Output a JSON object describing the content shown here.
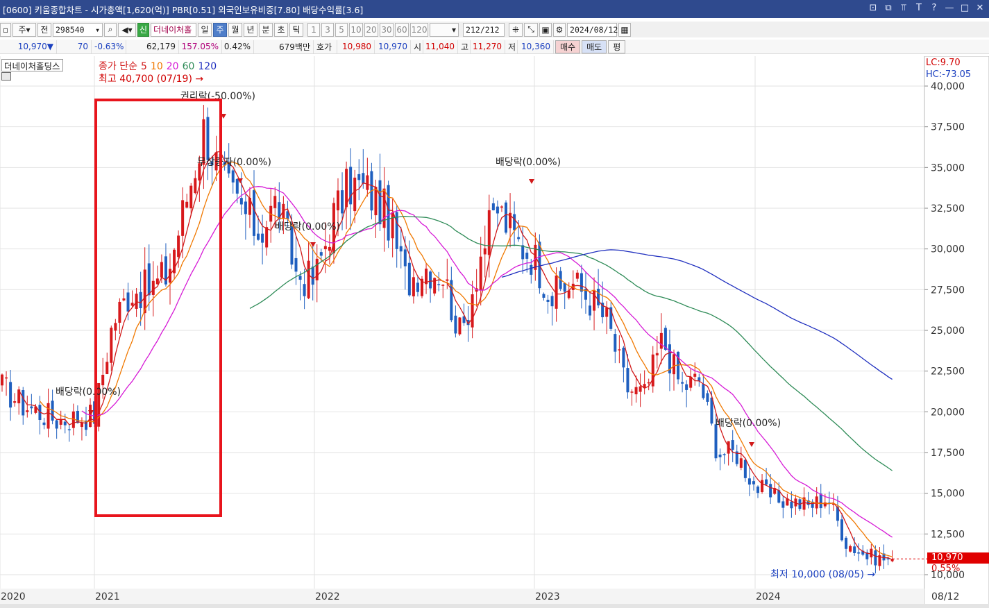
{
  "window": {
    "title": "[0600] 키움종합차트 - 시가총액[1,620(억)] PBR[0.51] 외국인보유비중[7.80] 배당수익률[3.6]",
    "controls": [
      "⊡",
      "⧉",
      "⫪",
      "T",
      "?",
      "—",
      "□",
      "✕"
    ]
  },
  "toolbar": {
    "period_unit": "주",
    "prev_label": "전",
    "code": "298540",
    "new_badge": "신",
    "stock_name": "더네이처홀",
    "periods": [
      "일",
      "주",
      "월",
      "년",
      "분",
      "초",
      "틱"
    ],
    "selected_period": "주",
    "intervals": [
      "1",
      "3",
      "5",
      "10",
      "20",
      "30",
      "60",
      "120"
    ],
    "count": "212",
    "count_total": "/212",
    "date": "2024/08/12"
  },
  "quote": {
    "price": "10,970",
    "arrow": "▼",
    "change": "70",
    "change_pct": "-0.63%",
    "volume": "62,179",
    "vol_ratio": "157.05%",
    "turnover": "0.42%",
    "amount": "679백만",
    "bid_label": "호가",
    "ask": "10,980",
    "bid": "10,970",
    "open_label": "시",
    "open": "11,040",
    "high_label": "고",
    "high": "11,270",
    "low_label": "저",
    "low": "10,360",
    "buy_btn": "매수",
    "sell_btn": "매도",
    "eval_btn": "평"
  },
  "chart_info": {
    "stock_label": "더네이처홀딩스",
    "legend_prefix": "종가 단순",
    "ma_periods": [
      "5",
      "10",
      "20",
      "60",
      "120"
    ],
    "ma_colors": [
      "#d11a1a",
      "#f07800",
      "#d61ad6",
      "#2e8b57",
      "#1f2fbf"
    ],
    "max_label": "최고 40,700 (07/19) →",
    "min_label": "최저 10,000 (08/05) →",
    "lc": "LC:9.70",
    "hc": "HC:-73.05",
    "current_price": "10,970",
    "current_pct": "0.55%",
    "annotations": {
      "rights1": "권리락(-50.00%)",
      "rights2": "무상증자(0.00%)",
      "div1": "배당락(0.00%)",
      "div2": "배당락(0.00%)",
      "div3": "배당락(0.00%)",
      "div4": "배당락(0.00%)"
    },
    "x_labels": [
      "2020",
      "2021",
      "2022",
      "2023",
      "2024",
      "08/12"
    ],
    "y_labels": [
      "40,000",
      "37,500",
      "35,000",
      "32,500",
      "30,000",
      "27,500",
      "25,000",
      "22,500",
      "20,000",
      "17,500",
      "15,000",
      "12,500",
      "10,000"
    ],
    "up_color": "#d7191c",
    "down_color": "#1f5fbf"
  },
  "chart_data": {
    "type": "candlestick",
    "y_ticks": [
      40000,
      37500,
      35000,
      32500,
      30000,
      27500,
      25000,
      22500,
      20000,
      17500,
      15000,
      12500,
      10000
    ],
    "ylim": [
      10000,
      40000
    ],
    "anchors": [
      {
        "date": "2019-12",
        "close": 23500
      },
      {
        "date": "2020-02",
        "close": 21000
      },
      {
        "date": "2020-03",
        "close": 18200
      },
      {
        "date": "2020-05",
        "close": 21500
      },
      {
        "date": "2020-07",
        "close": 22500
      },
      {
        "date": "2020-09",
        "close": 20500
      },
      {
        "date": "2020-11",
        "close": 19500
      },
      {
        "date": "2021-01",
        "close": 19800
      },
      {
        "date": "2021-02",
        "close": 25500
      },
      {
        "date": "2021-03",
        "close": 27500
      },
      {
        "date": "2021-04",
        "close": 27500
      },
      {
        "date": "2021-05",
        "close": 28500
      },
      {
        "date": "2021-06",
        "close": 33000
      },
      {
        "date": "2021-07",
        "close": 37500
      },
      {
        "date": "2021-08",
        "close": 34000
      },
      {
        "date": "2021-09",
        "close": 32500
      },
      {
        "date": "2021-10",
        "close": 31000
      },
      {
        "date": "2021-11",
        "close": 33000
      },
      {
        "date": "2021-12",
        "close": 28500
      },
      {
        "date": "2022-01",
        "close": 28000
      },
      {
        "date": "2022-02",
        "close": 32000
      },
      {
        "date": "2022-03",
        "close": 34000
      },
      {
        "date": "2022-04",
        "close": 33500
      },
      {
        "date": "2022-05",
        "close": 32000
      },
      {
        "date": "2022-06",
        "close": 28000
      },
      {
        "date": "2022-07",
        "close": 29000
      },
      {
        "date": "2022-08",
        "close": 28500
      },
      {
        "date": "2022-09",
        "close": 24500
      },
      {
        "date": "2022-10",
        "close": 29500
      },
      {
        "date": "2022-11",
        "close": 32500
      },
      {
        "date": "2022-12",
        "close": 30500
      },
      {
        "date": "2023-01",
        "close": 29500
      },
      {
        "date": "2023-02",
        "close": 27000
      },
      {
        "date": "2023-03",
        "close": 28000
      },
      {
        "date": "2023-04",
        "close": 27000
      },
      {
        "date": "2023-05",
        "close": 25500
      },
      {
        "date": "2023-06",
        "close": 21500
      },
      {
        "date": "2023-07",
        "close": 21000
      },
      {
        "date": "2023-08",
        "close": 24500
      },
      {
        "date": "2023-09",
        "close": 21500
      },
      {
        "date": "2023-10",
        "close": 22000
      },
      {
        "date": "2023-11",
        "close": 17500
      },
      {
        "date": "2023-12",
        "close": 17500
      },
      {
        "date": "2024-01",
        "close": 15500
      },
      {
        "date": "2024-02",
        "close": 14700
      },
      {
        "date": "2024-03",
        "close": 14500
      },
      {
        "date": "2024-04",
        "close": 14200
      },
      {
        "date": "2024-05",
        "close": 14800
      },
      {
        "date": "2024-06",
        "close": 12000
      },
      {
        "date": "2024-07",
        "close": 11200
      },
      {
        "date": "2024-08",
        "close": 10970
      }
    ]
  }
}
